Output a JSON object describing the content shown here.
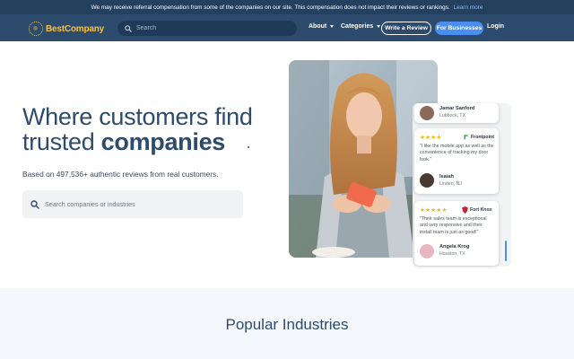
{
  "banner": {
    "text": "We may receive referral compensation from some of the companies on our site. This compensation does not impact their reviews or rankings.",
    "link": "Learn more"
  },
  "nav": {
    "logo": "BestCompany",
    "search_placeholder": "Search",
    "about": "About",
    "categories": "Categories",
    "write_review": "Write a Review",
    "for_businesses": "For Businesses",
    "login": "Login"
  },
  "hero": {
    "title_line1": "Where customers find",
    "title_line2_regular": "trusted ",
    "title_line2_bold": "companies",
    "subtitle": "Based on 497,536+ authentic reviews from real customers.",
    "search_placeholder": "Search companies or industries"
  },
  "reviews": [
    {
      "name": "Jamar Sanford",
      "location": "Lubbock, TX"
    },
    {
      "stars": "★★★★",
      "brand": "Frontpoint",
      "quote": "\"I like the mobile app as well as the convenience of tracking my door look.\"",
      "name": "Isaiah",
      "location": "Linden, NJ"
    },
    {
      "stars": "★★★★★",
      "brand": "Fort Knox",
      "quote": "\"Their sales team is exceptional and very responsive and their install team is just as good!\"",
      "name": "Angela Krog",
      "location": "Houston, TX"
    }
  ],
  "popular": {
    "title": "Popular Industries"
  },
  "colors": {
    "navy": "#2d4b6c",
    "banner": "#24405e",
    "accent_blue": "#4a8ff0",
    "gold": "#f3c34a",
    "star": "#f5b400"
  }
}
